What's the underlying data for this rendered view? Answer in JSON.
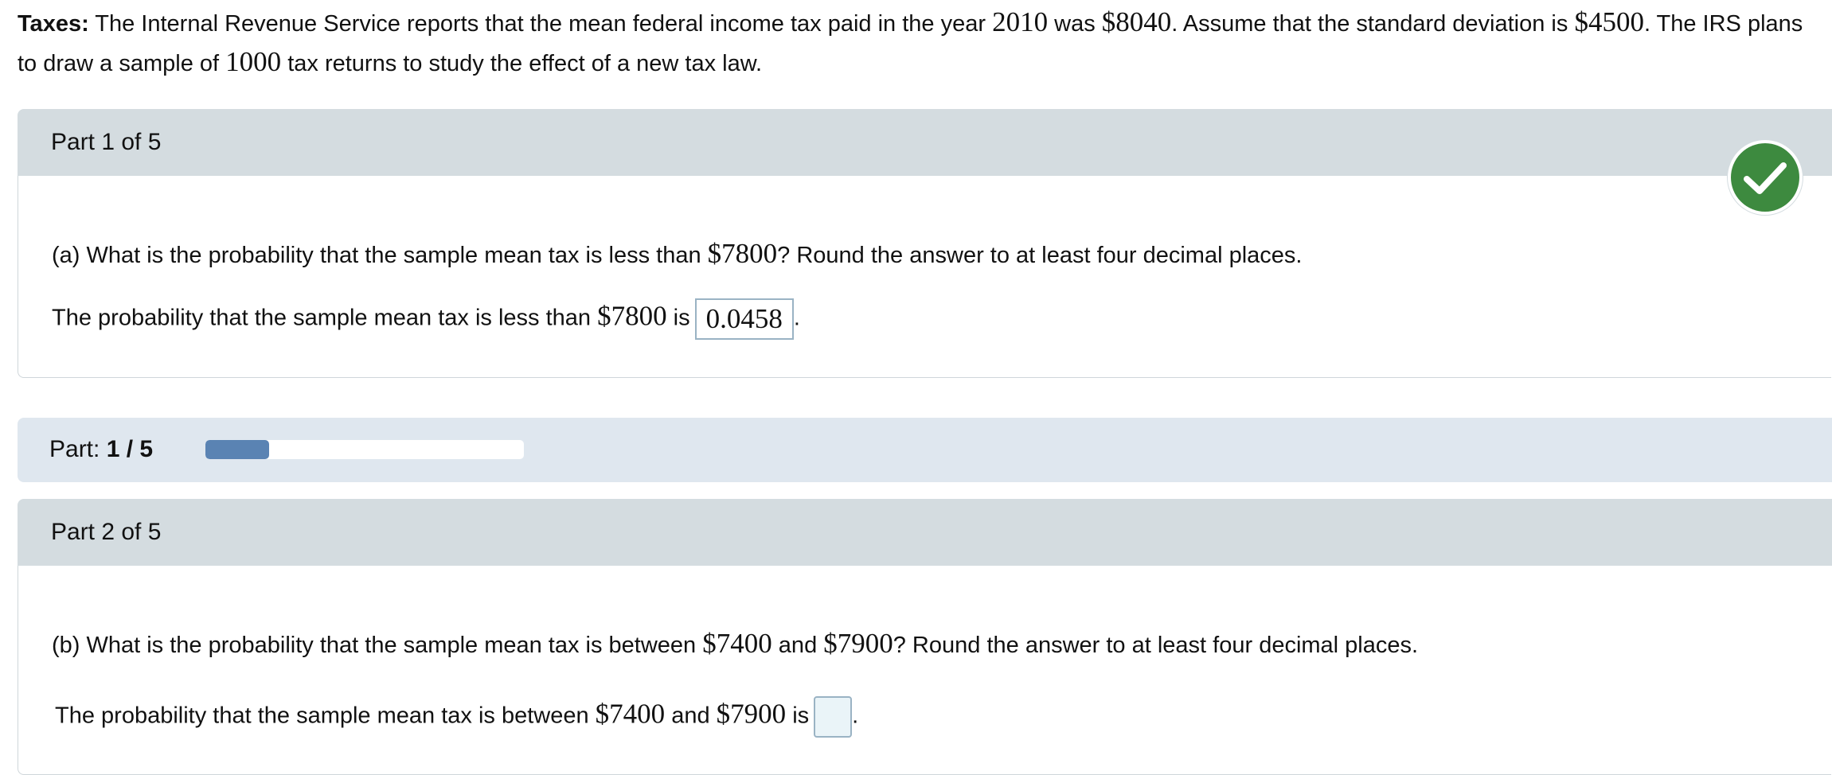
{
  "intro": {
    "label": "Taxes:",
    "text1": " The Internal Revenue Service reports that the mean federal income tax paid in the year ",
    "year": "2010",
    "text2": " was ",
    "mean": "$8040",
    "text3": ". Assume that the standard deviation is ",
    "sd": "$4500",
    "text4": ". The IRS plans to draw a sample of ",
    "n": "1000",
    "text5": " tax returns to study the effect of a new tax law."
  },
  "part1": {
    "title": "Part 1 of 5",
    "question_pre": "(a) What is the probability that the sample mean tax is less than ",
    "question_value": "$7800",
    "question_post": "? Round the answer to at least four decimal places.",
    "answer_pre": "The probability that the sample mean tax is less than ",
    "answer_value": "$7800",
    "answer_mid": " is",
    "answer": "0.0458",
    "answer_end": ".",
    "status_icon": "check-icon"
  },
  "progress": {
    "label": "Part: ",
    "current": "1 / 5",
    "fraction": 0.2,
    "fill_color": "#5a83b3"
  },
  "part2": {
    "title": "Part 2 of 5",
    "question_pre": "(b) What is the probability that the sample mean tax is between ",
    "question_v1": "$7400",
    "question_and": " and ",
    "question_v2": "$7900",
    "question_post": "? Round the answer to at least four decimal places.",
    "answer_pre": "The probability that the sample mean tax is between ",
    "answer_v1": "$7400",
    "answer_and": " and ",
    "answer_v2": "$7900",
    "answer_mid": " is",
    "answer": "",
    "answer_end": "."
  },
  "colors": {
    "header_bg": "#d4dce0",
    "progress_bg": "#dfe7ef",
    "success_green": "#3d8a3f"
  }
}
